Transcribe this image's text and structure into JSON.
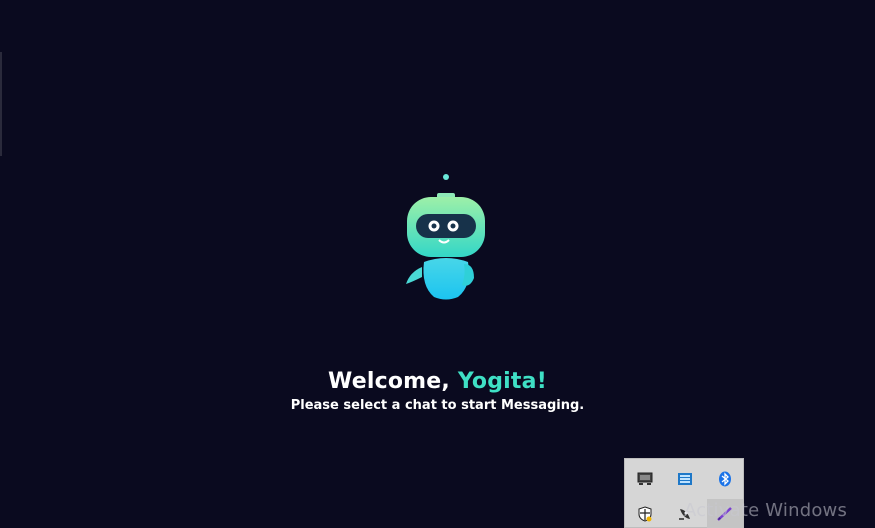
{
  "welcome": {
    "greeting": "Welcome, ",
    "name": "Yogita!",
    "subtitle": "Please select a chat to start Messaging."
  },
  "robot": {
    "icon": "robot-mascot-icon"
  },
  "tray": {
    "icons": [
      "monitor-icon",
      "network-adapter-icon",
      "bluetooth-icon",
      "security-shield-icon",
      "satellite-icon",
      "pen-icon"
    ]
  },
  "watermark": {
    "text": "Activate Windows"
  },
  "colors": {
    "background": "#0a0a1f",
    "accent": "#3fe0c5",
    "text": "#ffffff"
  }
}
